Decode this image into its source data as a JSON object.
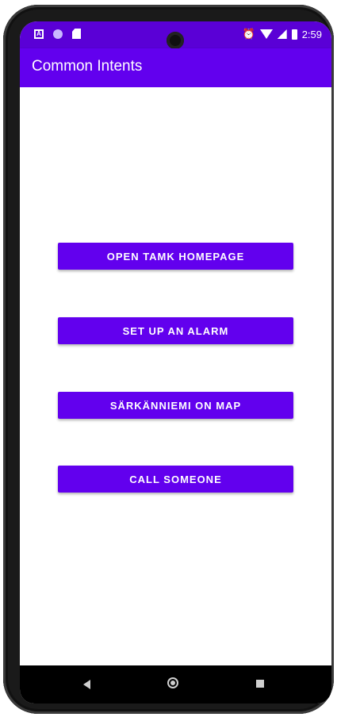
{
  "status_bar": {
    "time": "2:59",
    "left_icons": [
      "notification-a-icon",
      "circle-app-icon",
      "sd-card-icon"
    ],
    "right_icons": [
      "alarm-icon",
      "wifi-icon",
      "signal-icon",
      "battery-icon"
    ],
    "notification_letter": "A"
  },
  "app_bar": {
    "title": "Common Intents",
    "color": "#6200ee"
  },
  "buttons": {
    "open_homepage": "OPEN TAMK HOMEPAGE",
    "set_alarm": "SET UP AN ALARM",
    "map": "SÄRKÄNNIEMI ON MAP",
    "call": "CALL SOMEONE"
  },
  "nav_bar": {
    "icons": [
      "back-icon",
      "home-icon",
      "recents-icon"
    ]
  },
  "colors": {
    "primary": "#6200ee",
    "primary_dark": "#5a00d6",
    "button_text": "#ffffff"
  }
}
